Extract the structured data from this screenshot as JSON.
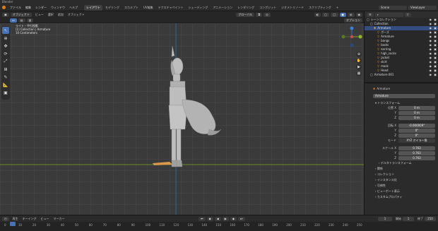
{
  "app": {
    "title": "Blender"
  },
  "menu": [
    "ファイル",
    "編集",
    "レンダー",
    "ウィンドウ",
    "ヘルプ"
  ],
  "workspaces": [
    "レイアウト",
    "モデリング",
    "スカルプト",
    "UV編集",
    "テクスチャペイント",
    "シェーディング",
    "アニメーション",
    "レンダリング",
    "コンポジット",
    "ジオメトリノード",
    "スクリプティング"
  ],
  "active_workspace": 0,
  "scene": {
    "label": "Scene",
    "view_layer": "ViewLayer"
  },
  "viewport": {
    "mode": "オブジェクト",
    "menus": [
      "ビュー",
      "選択",
      "追加",
      "オブジェクト"
    ],
    "transform": "グローバル",
    "options": "オプション",
    "info": [
      "ライト・平行投影",
      "(1) Collection | Armature",
      "10 Centimeters"
    ]
  },
  "outliner": {
    "header": "シーンコレクション",
    "rows": [
      {
        "label": "シーンコレクション",
        "indent": 0,
        "selected": false
      },
      {
        "label": "Collection",
        "indent": 1,
        "selected": false
      },
      {
        "label": "Armature",
        "indent": 2,
        "selected": true
      },
      {
        "label": "ポーズ",
        "indent": 3,
        "selected": false
      },
      {
        "label": "Armature",
        "indent": 3,
        "selected": false
      },
      {
        "label": "bangs",
        "indent": 3,
        "selected": false
      },
      {
        "label": "boots",
        "indent": 3,
        "selected": false
      },
      {
        "label": "earring",
        "indent": 3,
        "selected": false
      },
      {
        "label": "high_socks",
        "indent": 3,
        "selected": false
      },
      {
        "label": "jacket",
        "indent": 3,
        "selected": false
      },
      {
        "label": "skirt",
        "indent": 3,
        "selected": false
      },
      {
        "label": "mask",
        "indent": 3,
        "selected": false
      },
      {
        "label": "Head",
        "indent": 3,
        "selected": false
      },
      {
        "label": "Armature.001",
        "indent": 1,
        "selected": false
      }
    ]
  },
  "properties": {
    "object_name": "Armature",
    "name_field": "Armature",
    "section_transform": "トランスフォーム",
    "location_label": "位置 X",
    "rotation_label": "回転 X",
    "mode_label": "モード",
    "mode_value": "XYZ オイラー角",
    "scale_label": "スケール X",
    "y_label": "Y",
    "z_label": "Z",
    "loc": [
      "0 m",
      "0 m",
      "0 m"
    ],
    "rot": [
      "-0.000009°",
      "0°",
      "0°"
    ],
    "scale": [
      "0.763",
      "0.763",
      "0.763"
    ],
    "delta": "デルタトランスフォーム",
    "panels": [
      "関係",
      "コレクション",
      "インスタンス化",
      "可視性",
      "ビューポート表示",
      "カスタムプロパティ"
    ]
  },
  "timeline": {
    "menus": [
      "再生",
      "キーイング",
      "ビュー",
      "マーカー"
    ],
    "current_frame": "1",
    "start_label": "開始",
    "start": "1",
    "end_label": "終了",
    "end": "250",
    "ticks": [
      "0",
      "10",
      "20",
      "30",
      "40",
      "50",
      "60",
      "70",
      "80",
      "90",
      "100",
      "110",
      "120",
      "130",
      "140",
      "150",
      "160",
      "170",
      "180",
      "190",
      "200",
      "210",
      "220",
      "230",
      "240",
      "250"
    ]
  },
  "colors": {
    "accent": "#4772b3",
    "orange": "#e87d0d",
    "x_axis": "#d94c4c",
    "y_axis": "#8bbe1f",
    "z_axis": "#2f83e0"
  },
  "icons": [
    "blender-logo-icon",
    "cursor-icon",
    "move-icon",
    "rotate-icon",
    "scale-icon",
    "transform-icon",
    "annotate-icon",
    "measure-icon",
    "eye-icon",
    "camera-icon",
    "search-icon",
    "armature-icon",
    "mesh-icon",
    "play-icon"
  ]
}
